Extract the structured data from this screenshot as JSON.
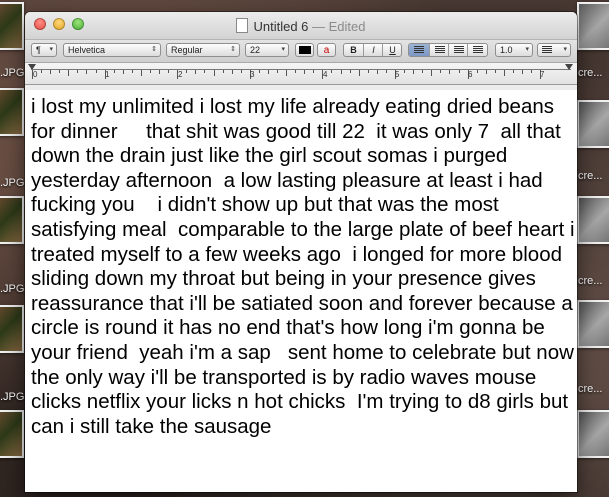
{
  "window": {
    "title": "Untitled 6",
    "separator": "—",
    "status": "Edited"
  },
  "toolbar": {
    "paragraph_style": "¶",
    "font_family": "Helvetica",
    "typeface": "Regular",
    "font_size": "22",
    "text_color": "#000000",
    "bold": "B",
    "italic": "I",
    "underline": "U",
    "line_spacing": "1.0",
    "list_icon": "list-icon"
  },
  "ruler": {
    "labels": [
      "0",
      "1",
      "2",
      "3",
      "4",
      "5",
      "6",
      "7"
    ]
  },
  "desktop": {
    "file_labels": [
      ".JPG",
      ".JPG",
      ".JPG",
      ".JPG",
      "cre...",
      "cre...",
      "cre...",
      "cre..."
    ]
  },
  "document": {
    "body": "i lost my unlimited i lost my life already eating dried beans for dinner     that shit was good till 22  it was only 7  all that down the drain just like the girl scout somas i purged yesterday afternoon  a low lasting pleasure at least i had fucking you    i didn't show up but that was the most satisfying meal  comparable to the large plate of beef heart i treated myself to a few weeks ago  i longed for more blood sliding down my throat but being in your presence gives reassurance that i'll be satiated soon and forever because a circle is round it has no end that's how long i'm gonna be your friend  yeah i'm a sap   sent home to celebrate but now the only way i'll be transported is by radio waves mouse clicks netflix your licks n hot chicks  I'm trying to d8 girls but can i still take the sausage"
  }
}
